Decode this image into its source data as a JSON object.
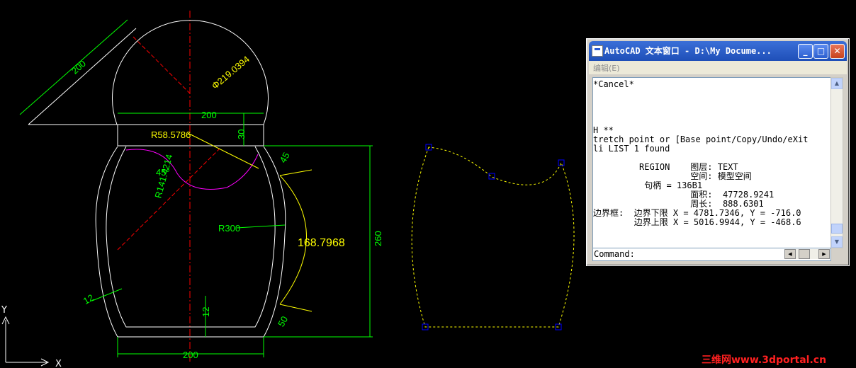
{
  "drawing": {
    "dimensions": {
      "top_width": "200",
      "diag_200": "200",
      "diameter": "Φ219.0394",
      "neck_height": "30",
      "radius_small": "R58.5786",
      "angle": "45°",
      "radius_large": "R141.4214",
      "dim_45_right": "45",
      "radius_300": "R300",
      "arc_length": "168.7968",
      "height_260": "260",
      "wall_12_left": "12",
      "wall_12_bottom": "12",
      "dim_50": "50",
      "bottom_width": "200"
    },
    "axis": {
      "x": "X",
      "y": "Y"
    }
  },
  "text_window": {
    "title": "AutoCAD 文本窗口 - D:\\My Docume...",
    "menu_edit": "编辑(E)",
    "lines": [
      "*Cancel*",
      "",
      "",
      "",
      "",
      "H **",
      "tretch point or [Base point/Copy/Undo/eXit",
      "li LIST 1 found",
      "",
      "         REGION    图层: TEXT",
      "                   空间: 模型空间",
      "          句柄 = 136B1",
      "                   面积:  47728.9241",
      "                   周长:  888.6301",
      "边界框:  边界下限 X = 4781.7346, Y = -716.0",
      "        边界上限 X = 5016.9944, Y = -468.6"
    ],
    "command_label": "Command:"
  },
  "watermark": "三维网www.3dportal.cn",
  "colors": {
    "background": "#000000",
    "geometry": "#ffffff",
    "dimension": "#00ff00",
    "dimension_text": "#ffff00",
    "centerline": "#ff0000",
    "arc": "#ff00ff",
    "grip": "#0000ff",
    "title_bar": "#2a5bd4"
  }
}
